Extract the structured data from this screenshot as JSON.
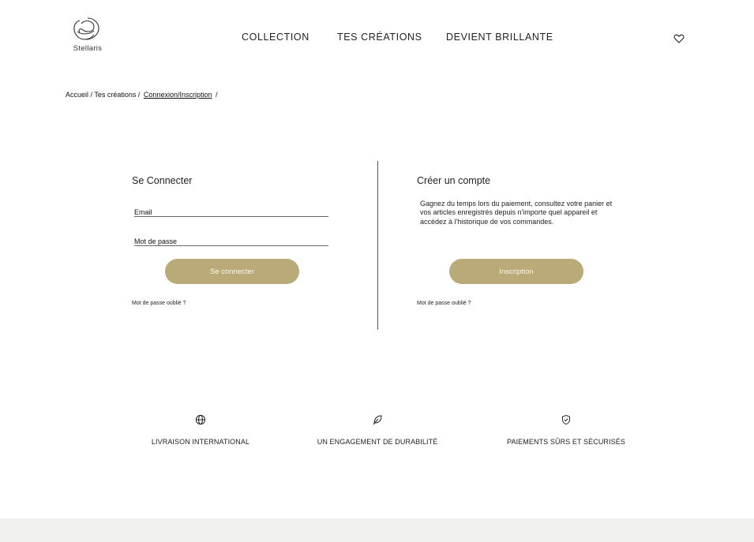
{
  "brand": {
    "name": "Stellaris",
    "logo_icon": "swirl-logo-icon"
  },
  "nav": {
    "items": [
      {
        "label": "COLLECTION"
      },
      {
        "label": "TES CRÉATIONS"
      },
      {
        "label": "DEVIENT BRILLANTE"
      }
    ],
    "favorites_icon": "heart-icon"
  },
  "breadcrumb": {
    "items": [
      "Accueil",
      "/ Tes créations /",
      "Connexion/Inscription",
      "/"
    ]
  },
  "login": {
    "title": "Se Connecter",
    "email_placeholder": "Email",
    "password_placeholder": "Mot de passe",
    "submit_label": "Se connecter",
    "forgot_label": "Mot de passe oublié ?"
  },
  "register": {
    "title": "Créer un compte",
    "description": "Gagnez du temps lors du paiement, consultez votre panier et vos articles enregistrés depuis n'importe quel appareil et accédez à l'historique de vos commandes.",
    "submit_label": "Inscription",
    "forgot_label": "Mot de passe oublié ?"
  },
  "features": [
    {
      "icon": "globe-icon",
      "label": "LIVRAISON INTERNATIONAL"
    },
    {
      "icon": "leaf-icon",
      "label": "UN ENGAGEMENT DE DURABILITÉ"
    },
    {
      "icon": "shield-check-icon",
      "label": "PAIEMENTS SÛRS ET SÉCURISÉS"
    }
  ],
  "colors": {
    "accent": "#b9aa78",
    "footer": "#f0f0ec"
  }
}
